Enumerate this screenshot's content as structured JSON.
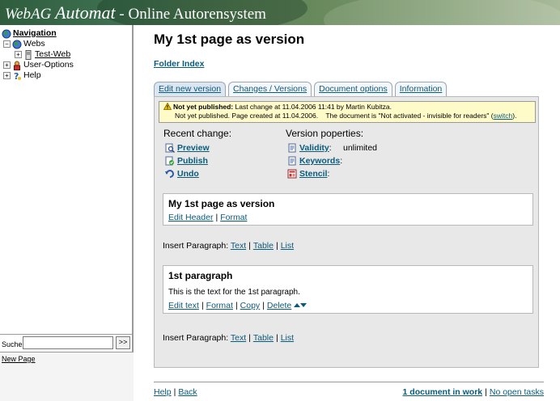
{
  "banner": {
    "brand_webag": "WebAG",
    "brand_automat": "Automat",
    "subtitle": " - Online Autorensystem"
  },
  "tree": {
    "navigation": "Navigation",
    "webs": "Webs",
    "test_web": "Test-Web",
    "user_options": "User-Options",
    "help": "Help"
  },
  "search": {
    "label": "Suche:",
    "value": "",
    "go": ">>"
  },
  "lower": {
    "new_page": "New Page"
  },
  "main": {
    "title": "My 1st page as version",
    "folder_index": "Folder Index",
    "tabs": [
      {
        "label": "Edit new version"
      },
      {
        "label": "Changes / Versions"
      },
      {
        "label": "Document options"
      },
      {
        "label": "Information"
      }
    ],
    "notice": {
      "bold": "Not yet published:",
      "line1": " Last change at 11.04.2006 11:41 by Martin Kubitza.",
      "line2": "Not yet published. Page created at 11.04.2006.    The document is \"Not activated - invisible for readers\" (",
      "switch": "switch",
      "line2_end": ")."
    },
    "recent_change": {
      "heading": "Recent change:",
      "preview": "Preview",
      "publish": "Publish",
      "undo": "Undo"
    },
    "version_properties": {
      "heading": "Version poperties:",
      "validity": "Validity",
      "validity_value": "unlimited",
      "keywords": "Keywords",
      "stencil": "Stencil",
      "colon": ":"
    },
    "header_box": {
      "title": "My 1st page as version",
      "edit_header": "Edit Header",
      "format": "Format"
    },
    "insert": {
      "label": "Insert Paragraph: ",
      "text": "Text",
      "table": "Table",
      "list": "List"
    },
    "paragraph_box": {
      "title": "1st paragraph",
      "body": "This is the text for the 1st paragraph.",
      "edit_text": "Edit text",
      "format": "Format",
      "copy": "Copy",
      "delete": "Delete"
    },
    "separator": "|"
  },
  "footer": {
    "help": "Help",
    "back": "Back",
    "in_work": "1 document in work",
    "open_tasks": "No open tasks"
  },
  "colors": {
    "link": "#0a5a7a",
    "notice_bg": "#fffbc8",
    "panel_bg": "#e8e8e8",
    "tab_active": "#dbe6f0"
  }
}
